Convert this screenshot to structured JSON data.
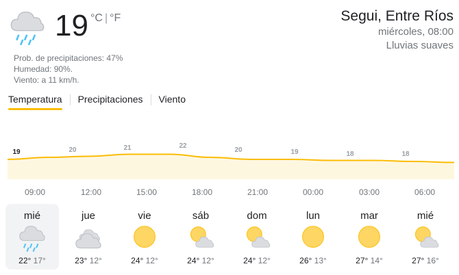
{
  "current": {
    "temperature": "19",
    "unit_c": "°C",
    "unit_f": "°F",
    "icon": "rain-cloud-icon",
    "precipitation": "Prob. de precipitaciones: 47%",
    "humidity": "Humedad: 90%.",
    "wind": "Viento: a 11 km/h."
  },
  "location": {
    "city": "Segui, Entre Ríos",
    "datetime": "miércoles, 08:00",
    "condition": "Lluvias suaves"
  },
  "tabs": [
    {
      "label": "Temperatura",
      "active": true
    },
    {
      "label": "Precipitaciones",
      "active": false
    },
    {
      "label": "Viento",
      "active": false
    }
  ],
  "hourly": {
    "times": [
      "09:00",
      "12:00",
      "15:00",
      "18:00",
      "21:00",
      "00:00",
      "03:00",
      "06:00"
    ],
    "labels": [
      "19",
      "20",
      "21",
      "22",
      "20",
      "19",
      "18",
      "18"
    ],
    "temps": [
      19,
      20,
      20.5,
      21.5,
      21.5,
      20,
      19,
      19,
      18.5,
      18.5,
      18,
      17.5
    ],
    "line_color": "#fbbc04",
    "fill_color": "#fef7e0"
  },
  "daily": [
    {
      "day": "mié",
      "high": "22°",
      "low": "17°",
      "icon": "rain-cloud-icon",
      "selected": true
    },
    {
      "day": "jue",
      "high": "23°",
      "low": "12°",
      "icon": "cloudy-icon",
      "selected": false
    },
    {
      "day": "vie",
      "high": "24°",
      "low": "12°",
      "icon": "sun-icon",
      "selected": false
    },
    {
      "day": "sáb",
      "high": "24°",
      "low": "12°",
      "icon": "partly-cloudy-icon",
      "selected": false
    },
    {
      "day": "dom",
      "high": "24°",
      "low": "12°",
      "icon": "partly-cloudy-icon",
      "selected": false
    },
    {
      "day": "lun",
      "high": "26°",
      "low": "13°",
      "icon": "sun-icon",
      "selected": false
    },
    {
      "day": "mar",
      "high": "27°",
      "low": "14°",
      "icon": "sun-icon",
      "selected": false
    },
    {
      "day": "mié",
      "high": "27°",
      "low": "16°",
      "icon": "partly-cloudy-icon",
      "selected": false
    }
  ],
  "colors": {
    "sun": "#fdd663",
    "sun_stroke": "#fbbc04",
    "cloud": "#dadce0",
    "cloud_stroke": "#bdc1c6",
    "rain": "#4fc3f7"
  }
}
